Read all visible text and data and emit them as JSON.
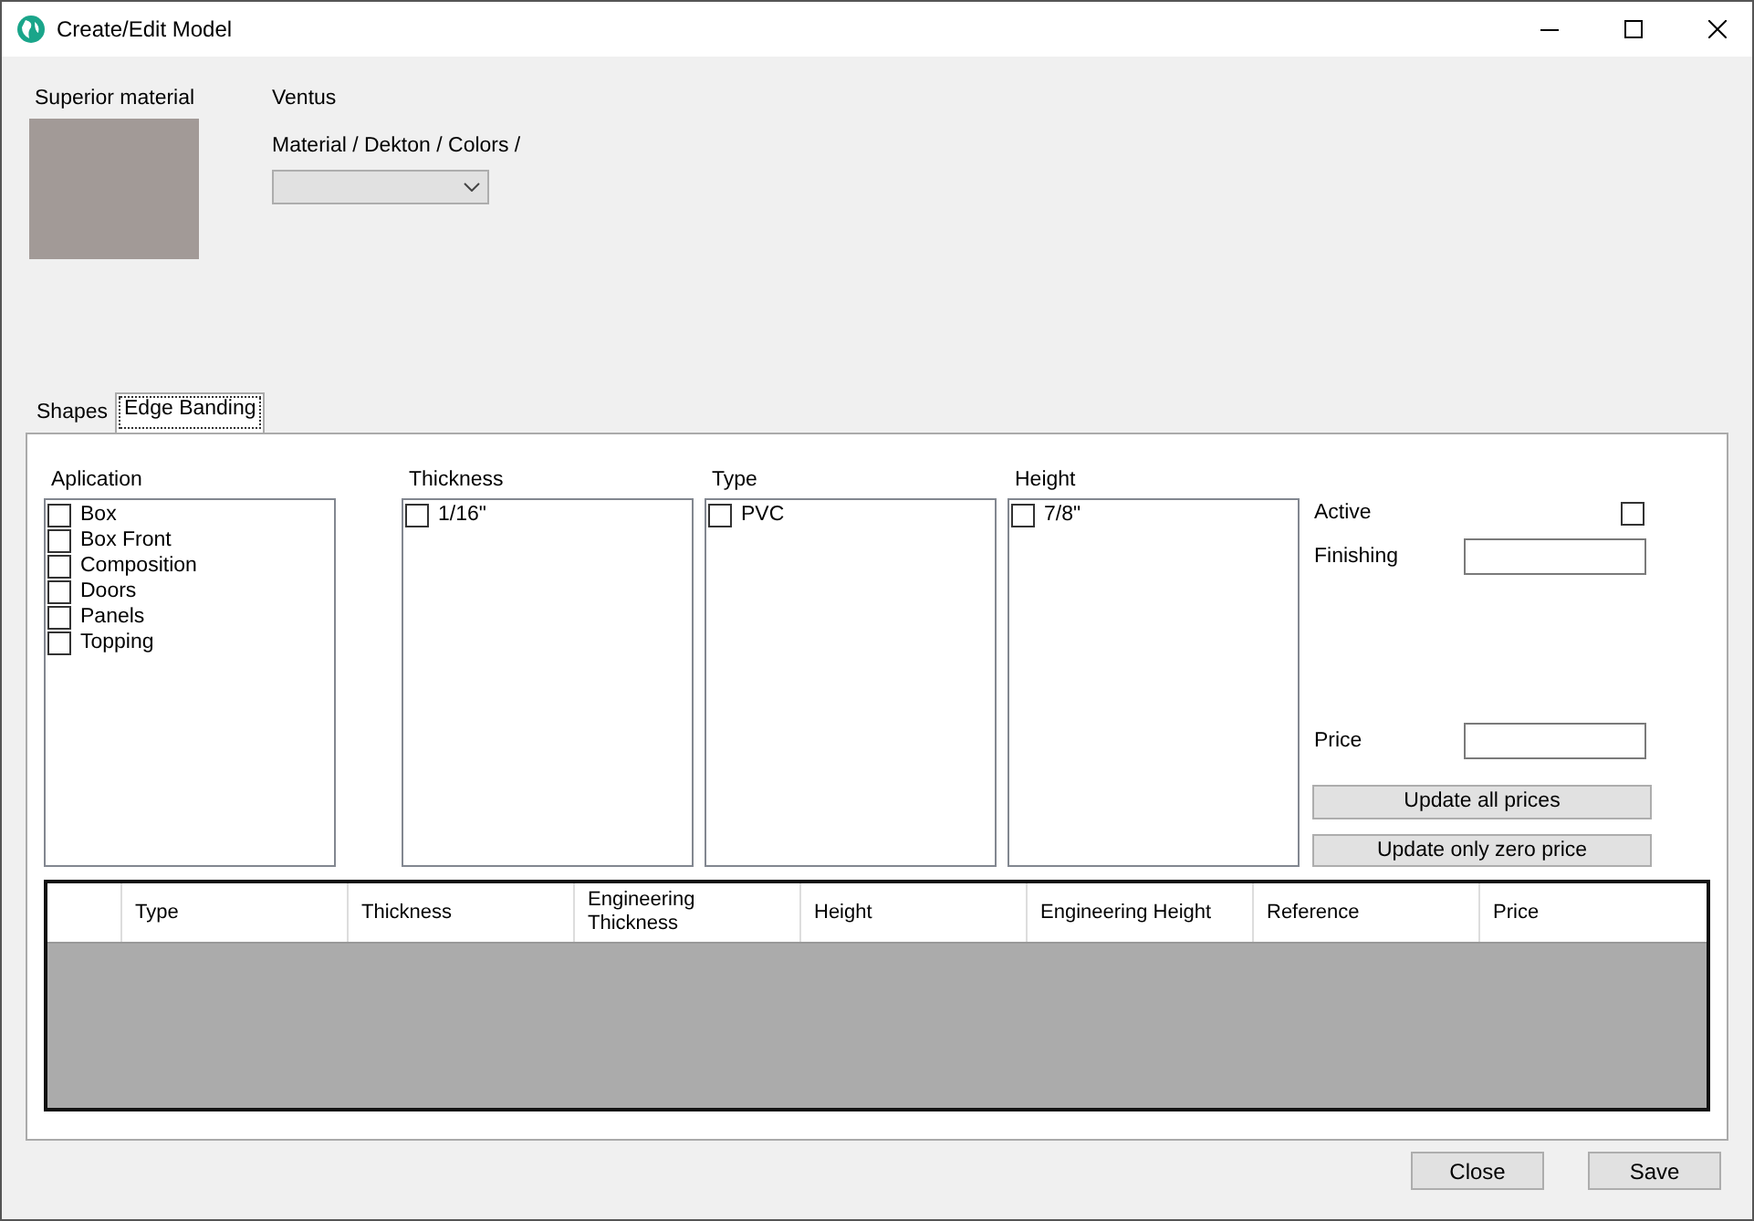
{
  "window": {
    "title": "Create/Edit Model"
  },
  "material": {
    "label": "Superior material",
    "name": "Ventus",
    "path": "Material / Dekton / Colors /"
  },
  "tabs": [
    {
      "label": "Shapes",
      "selected": false
    },
    {
      "label": "Edge Banding",
      "selected": true
    }
  ],
  "lists": [
    {
      "title": "Aplication",
      "items": [
        {
          "label": "Box",
          "checked": false
        },
        {
          "label": "Box Front",
          "checked": false
        },
        {
          "label": "Composition",
          "checked": false
        },
        {
          "label": "Doors",
          "checked": false
        },
        {
          "label": "Panels",
          "checked": false
        },
        {
          "label": "Topping",
          "checked": false
        }
      ]
    },
    {
      "title": "Thickness",
      "items": [
        {
          "label": "1/16\"",
          "checked": false
        }
      ]
    },
    {
      "title": "Type",
      "items": [
        {
          "label": "PVC",
          "checked": false
        }
      ]
    },
    {
      "title": "Height",
      "items": [
        {
          "label": "7/8\"",
          "checked": false
        }
      ]
    }
  ],
  "active": {
    "label": "Active",
    "checked": false
  },
  "finishing": {
    "label": "Finishing"
  },
  "price": {
    "label": "Price"
  },
  "update_buttons": [
    "Update all prices",
    "Update only zero price"
  ],
  "table": {
    "columns": [
      "Type",
      "Thickness",
      "Engineering Thickness",
      "Height",
      "Engineering Height",
      "Reference",
      "Price"
    ]
  },
  "buttons": [
    "Close",
    "Save"
  ]
}
